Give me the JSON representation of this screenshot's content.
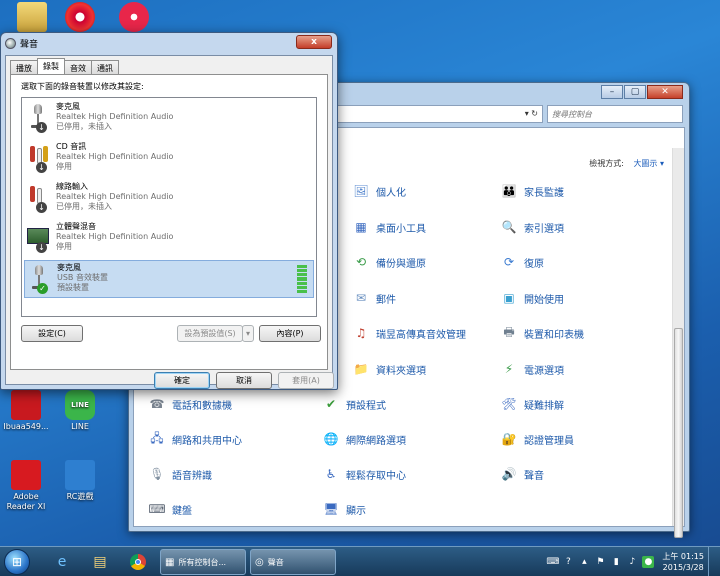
{
  "desktop": {
    "icons": [
      {
        "label": "Ibuaa549...",
        "color": "#c8191f"
      },
      {
        "label": "LINE",
        "color": "#3bb54a"
      },
      {
        "label": "Adobe Reader XI",
        "color": "#d71a20"
      },
      {
        "label": "RC遊戲",
        "color": "#2e7fd0"
      }
    ]
  },
  "control_panel": {
    "search_placeholder": "搜尋控制台",
    "view_by_label": "檢視方式:",
    "view_by_value": "大圖示 ▾",
    "items": [
      {
        "label": "個人化",
        "icon": "personalization-icon",
        "glyph": "🖼",
        "color": "#5a8ad0"
      },
      {
        "label": "家長監護",
        "icon": "parental-controls-icon",
        "glyph": "👪",
        "color": "#3c8c3c"
      },
      {
        "label": "桌面小工具",
        "icon": "gadgets-icon",
        "glyph": "▦",
        "color": "#3a6ac0"
      },
      {
        "label": "索引選項",
        "icon": "indexing-options-icon",
        "glyph": "🔍",
        "color": "#7a8aa0"
      },
      {
        "label": "備份與還原",
        "icon": "backup-restore-icon",
        "glyph": "⟲",
        "color": "#3b9c4a"
      },
      {
        "label": "復原",
        "icon": "recovery-icon",
        "glyph": "⟳",
        "color": "#3a7ad0"
      },
      {
        "label": "郵件",
        "icon": "mail-icon",
        "glyph": "✉",
        "color": "#6a90c0"
      },
      {
        "label": "開始使用",
        "icon": "getting-started-icon",
        "glyph": "▣",
        "color": "#3aa0d0"
      },
      {
        "label": "瑞昱高傳真音效管理",
        "icon": "realtek-audio-icon",
        "glyph": "♫",
        "color": "#c04030"
      },
      {
        "label": "裝置和印表機",
        "icon": "devices-printers-icon",
        "glyph": "🖶",
        "color": "#708090"
      },
      {
        "label": "資料夾選項",
        "icon": "folder-options-icon",
        "glyph": "📁",
        "color": "#d8b040"
      },
      {
        "label": "電源選項",
        "icon": "power-options-icon",
        "glyph": "⚡",
        "color": "#3b9c4a"
      },
      {
        "label": "電話和數據機",
        "icon": "phone-modem-icon",
        "glyph": "☎",
        "color": "#7a8490"
      },
      {
        "label": "預設程式",
        "icon": "default-programs-icon",
        "glyph": "✔",
        "color": "#3a9c3a"
      },
      {
        "label": "疑難排解",
        "icon": "troubleshooting-icon",
        "glyph": "🛠",
        "color": "#3a6ac0"
      },
      {
        "label": "網路和共用中心",
        "icon": "network-sharing-icon",
        "glyph": "🖧",
        "color": "#3a6ac0"
      },
      {
        "label": "網際網路選項",
        "icon": "internet-options-icon",
        "glyph": "🌐",
        "color": "#3a8ad0"
      },
      {
        "label": "認證管理員",
        "icon": "credential-manager-icon",
        "glyph": "🔐",
        "color": "#c09030"
      },
      {
        "label": "語音辨識",
        "icon": "speech-recognition-icon",
        "glyph": "🎙",
        "color": "#8090a0"
      },
      {
        "label": "輕鬆存取中心",
        "icon": "ease-of-access-icon",
        "glyph": "♿",
        "color": "#3a6ac0"
      },
      {
        "label": "聲音",
        "icon": "sound-icon",
        "glyph": "🔊",
        "color": "#8090a0"
      },
      {
        "label": "鍵盤",
        "icon": "keyboard-icon",
        "glyph": "⌨",
        "color": "#606a78"
      },
      {
        "label": "顯示",
        "icon": "display-icon",
        "glyph": "🖥",
        "color": "#3a6ac0"
      }
    ]
  },
  "sound_dialog": {
    "title": "聲音",
    "close_label": "x",
    "tabs": [
      "播放",
      "錄製",
      "音效",
      "通訊"
    ],
    "active_tab": 1,
    "instruction": "選取下面的錄音裝置以修改其設定:",
    "devices": [
      {
        "name": "麥克風",
        "driver": "Realtek High Definition Audio",
        "status": "已停用，未插入",
        "icon": "microphone-icon",
        "badge": "disconnected"
      },
      {
        "name": "CD 音訊",
        "driver": "Realtek High Definition Audio",
        "status": "停用",
        "icon": "cd-audio-jack-icon",
        "badge": "disconnected"
      },
      {
        "name": "線路輸入",
        "driver": "Realtek High Definition Audio",
        "status": "已停用，未插入",
        "icon": "line-in-jack-icon",
        "badge": "disconnected"
      },
      {
        "name": "立體聲混音",
        "driver": "Realtek High Definition Audio",
        "status": "停用",
        "icon": "sound-card-icon",
        "badge": "disconnected"
      },
      {
        "name": "麥克風",
        "driver": "USB 音效裝置",
        "status": "預設裝置",
        "icon": "microphone-icon",
        "badge": "default",
        "selected": true
      }
    ],
    "buttons": {
      "configure": "設定(C)",
      "set_default": "設為預設值(S)",
      "properties": "內容(P)",
      "ok": "確定",
      "cancel": "取消",
      "apply": "套用(A)"
    }
  },
  "taskbar": {
    "buttons": [
      {
        "label": "所有控制台..."
      },
      {
        "label": "聲音"
      }
    ],
    "clock_time": "上午 01:15",
    "clock_date": "2015/3/28"
  }
}
